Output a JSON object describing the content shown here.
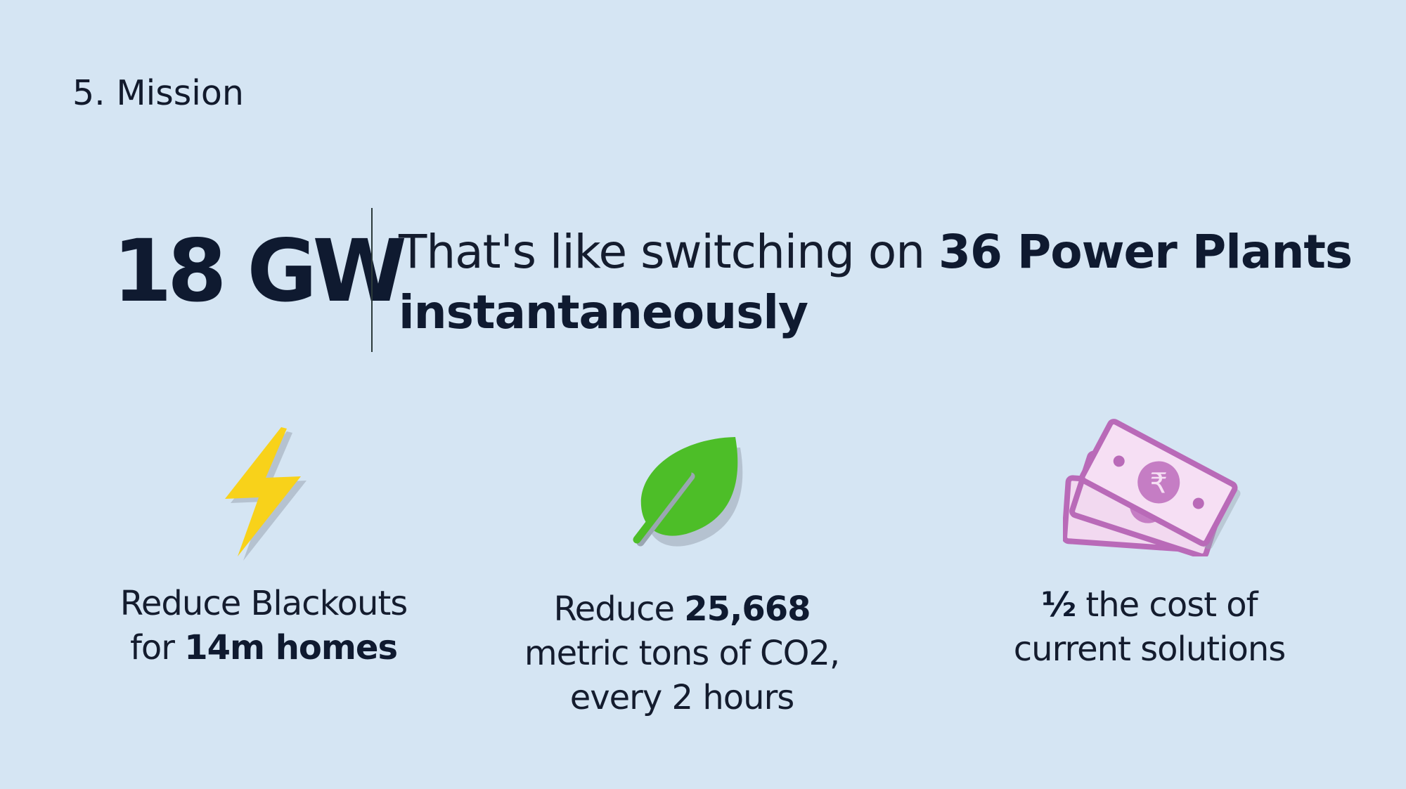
{
  "slide": {
    "section_title": "5. Mission",
    "headline": {
      "number": "18 GW",
      "text_plain": "That's like switching on ",
      "text_bold": "36 Power Plants instantaneously"
    },
    "features": [
      {
        "icon": "lightning-bolt-icon",
        "line1_plain": "Reduce Blackouts",
        "line2_plain": "for ",
        "line2_bold": "14m homes"
      },
      {
        "icon": "leaf-icon",
        "line1_plain": "Reduce ",
        "line1_bold": "25,668",
        "line2_plain": "metric tons of CO2,",
        "line3_plain": "every 2 hours"
      },
      {
        "icon": "rupee-banknotes-icon",
        "line1_bold": "½",
        "line1_plain": " the cost of",
        "line2_plain": "current solutions"
      }
    ],
    "colors": {
      "background": "#d5e5f3",
      "text": "#121a2c",
      "bolt": "#f7d11a",
      "leaf": "#4dbe28",
      "money": "#c06fc1"
    }
  }
}
